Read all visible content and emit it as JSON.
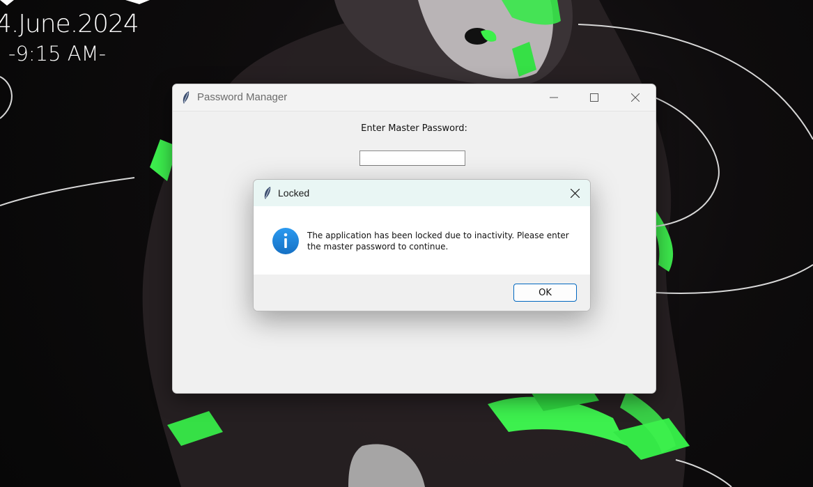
{
  "desktop": {
    "date_text": "4.June.2024",
    "time_text": "-9:15 AM-"
  },
  "app_window": {
    "title": "Password Manager",
    "icon": "feather-icon",
    "controls": [
      "minimize-icon",
      "maximize-icon",
      "close-icon"
    ],
    "prompt_label": "Enter Master Password:",
    "password_value": ""
  },
  "dialog": {
    "title": "Locked",
    "icon": "info-icon",
    "message": "The application has been locked due to inactivity. Please enter the master password to continue.",
    "ok_label": "OK",
    "accent_color": "#0067c0",
    "info_color": "#1e88d8"
  }
}
